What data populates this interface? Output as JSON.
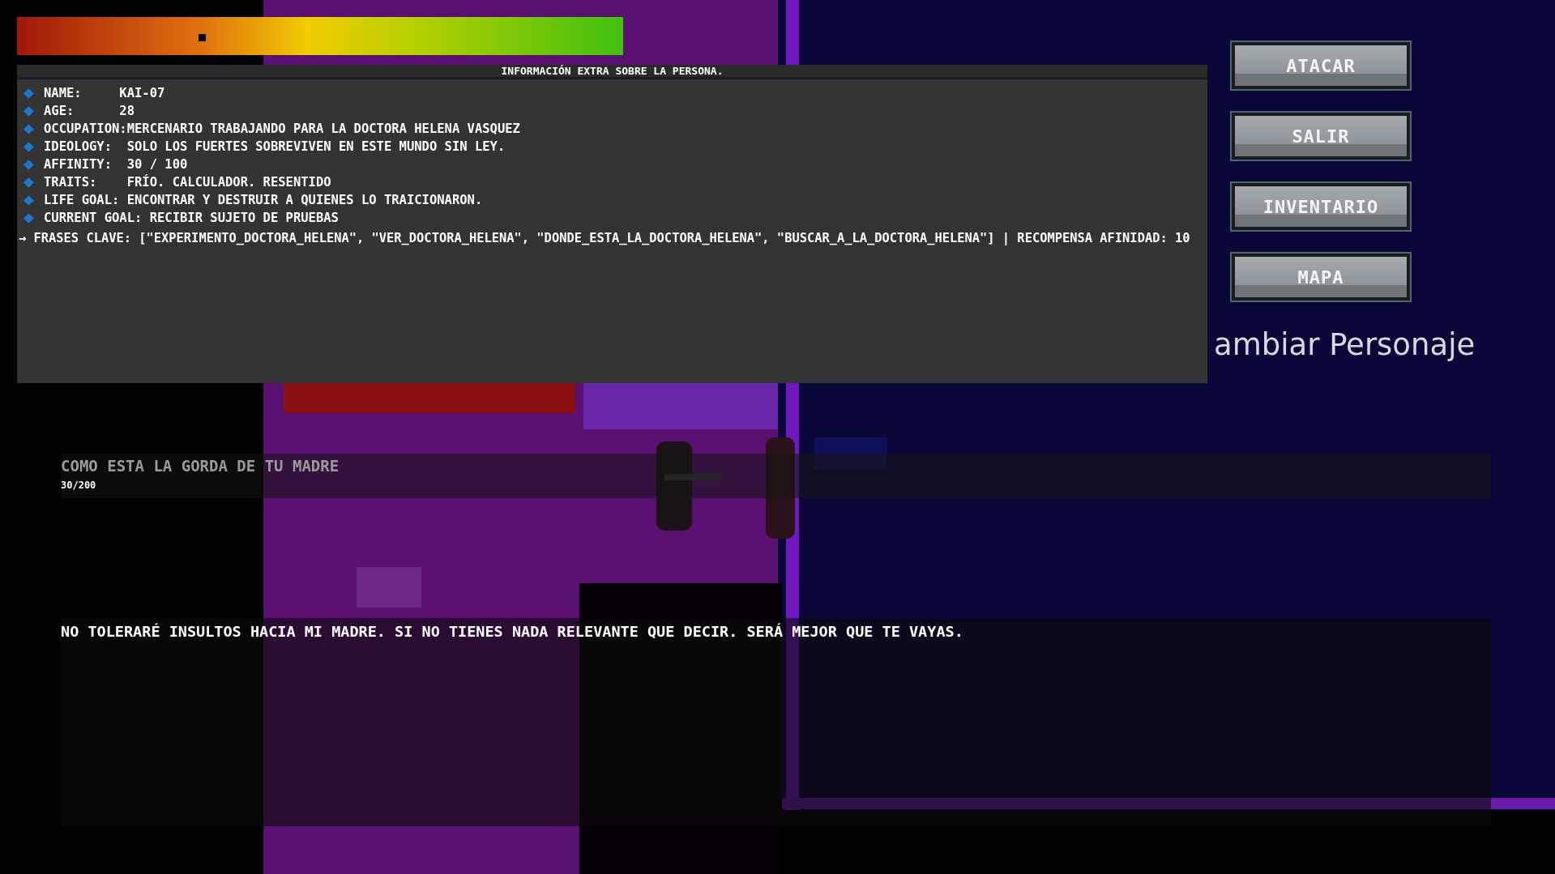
{
  "health_bar": {
    "level": 0.3
  },
  "info_panel": {
    "title": "INFORMACIÓN EXTRA SOBRE LA PERSONA.",
    "items": [
      "NAME:     KAI-07",
      "AGE:      28",
      "OCCUPATION:MERCENARIO TRABAJANDO PARA LA DOCTORA HELENA VASQUEZ",
      "IDEOLOGY:  SOLO LOS FUERTES SOBREVIVEN EN ESTE MUNDO SIN LEY.",
      "AFFINITY:  30 / 100",
      "TRAITS:    FRÍO. CALCULADOR. RESENTIDO",
      "LIFE GOAL: ENCONTRAR Y DESTRUIR A QUIENES LO TRAICIONARON.",
      "CURRENT GOAL: RECIBIR SUJETO DE PRUEBAS"
    ],
    "key_phrases": "→ FRASES CLAVE: [\"EXPERIMENTO_DOCTORA_HELENA\", \"VER_DOCTORA_HELENA\", \"DONDE_ESTA_LA_DOCTORA_HELENA\", \"BUSCAR_A_LA_DOCTORA_HELENA\"] | RECOMPENSA AFINIDAD: 10"
  },
  "buttons": [
    "ATACAR",
    "SALIR",
    "INVENTARIO",
    "MAPA"
  ],
  "switch_character": "ambiar Personaje",
  "chat_input": {
    "value": "COMO ESTA LA GORDA DE TU MADRE",
    "counter": "30/200"
  },
  "response": "NO TOLERARÉ INSULTOS HACIA MI MADRE. SI NO TIENES NADA RELEVANTE QUE DECIR. SERÁ MEJOR QUE TE VAYAS."
}
